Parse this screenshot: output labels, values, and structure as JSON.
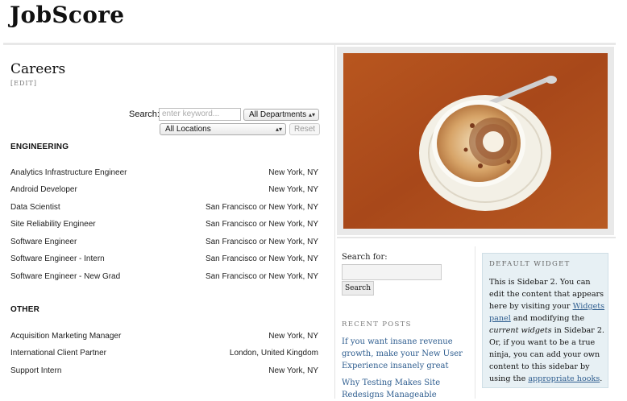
{
  "header": {
    "site_title": "JobScore"
  },
  "main": {
    "page_title": "Careers",
    "edit_label": "[EDIT]",
    "search": {
      "label": "Search:",
      "keyword_placeholder": "enter keyword...",
      "department_selected": "All Departments",
      "location_selected": "All Locations",
      "reset_label": "Reset"
    },
    "departments": [
      {
        "name": "ENGINEERING",
        "jobs": [
          {
            "title": "Analytics Infrastructure Engineer",
            "location": "New York, NY"
          },
          {
            "title": "Android Developer",
            "location": "New York, NY"
          },
          {
            "title": "Data Scientist",
            "location": "San Francisco or New York, NY"
          },
          {
            "title": "Site Reliability Engineer",
            "location": "San Francisco or New York, NY"
          },
          {
            "title": "Software Engineer",
            "location": "San Francisco or New York, NY"
          },
          {
            "title": "Software Engineer - Intern",
            "location": "San Francisco or New York, NY"
          },
          {
            "title": "Software Engineer - New Grad",
            "location": "San Francisco or New York, NY"
          }
        ]
      },
      {
        "name": "OTHER",
        "jobs": [
          {
            "title": "Acquisition Marketing Manager",
            "location": "New York, NY"
          },
          {
            "title": "International Client Partner",
            "location": "London, United Kingdom"
          },
          {
            "title": "Support Intern",
            "location": "New York, NY"
          }
        ]
      }
    ]
  },
  "sidebar1": {
    "search_label": "Search for:",
    "search_button": "Search",
    "recent_posts_heading": "Recent Posts",
    "recent_posts": [
      "If you want insane revenue growth, make your New User Experience insanely great",
      "Why Testing Makes Site Redesigns Manageable"
    ]
  },
  "sidebar2": {
    "widget_title": "Default Widget",
    "text_1": "This is Sidebar 2. You can edit the content that appears here by visiting your ",
    "link_widgets": "Widgets panel",
    "text_2": " and modifying the ",
    "em_current_widgets": "current widgets",
    "text_3": " in Sidebar 2. Or, if you want to be a true ninja, you can add your own content to this sidebar by using the ",
    "link_hooks": "appropriate hooks",
    "text_4": "."
  },
  "colors": {
    "accent_link": "#2e5d8f",
    "widget_bg": "#e7f0f4",
    "photo_bg": "#b4521d"
  },
  "icons": {
    "select_arrow": "updown-arrows-icon"
  }
}
